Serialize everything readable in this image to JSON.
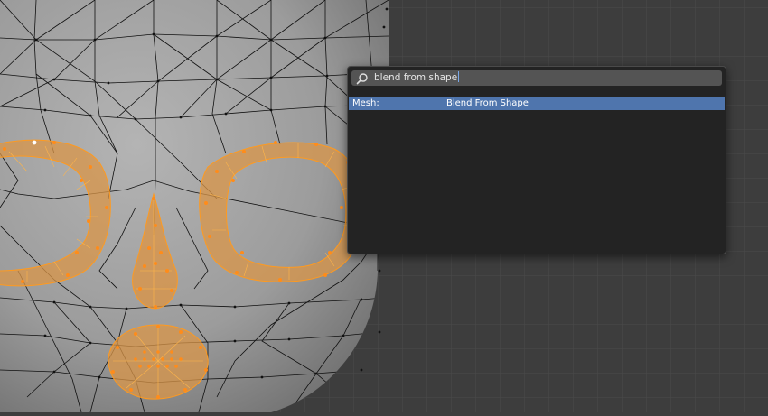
{
  "search": {
    "query": "blend from shape"
  },
  "results": [
    {
      "category": "Mesh:",
      "label": "Blend From Shape",
      "selected": true
    }
  ],
  "colors": {
    "viewport_bg": "#3d3d3d",
    "grid_line": "#4a4a4a",
    "mesh_surface": "#9e9e9e",
    "wire": "#111111",
    "selection": "#ff9a1f",
    "popup_bg": "#232323",
    "field_bg": "#545454",
    "highlight": "#4f75ad"
  },
  "icons": {
    "search": "search-icon"
  }
}
